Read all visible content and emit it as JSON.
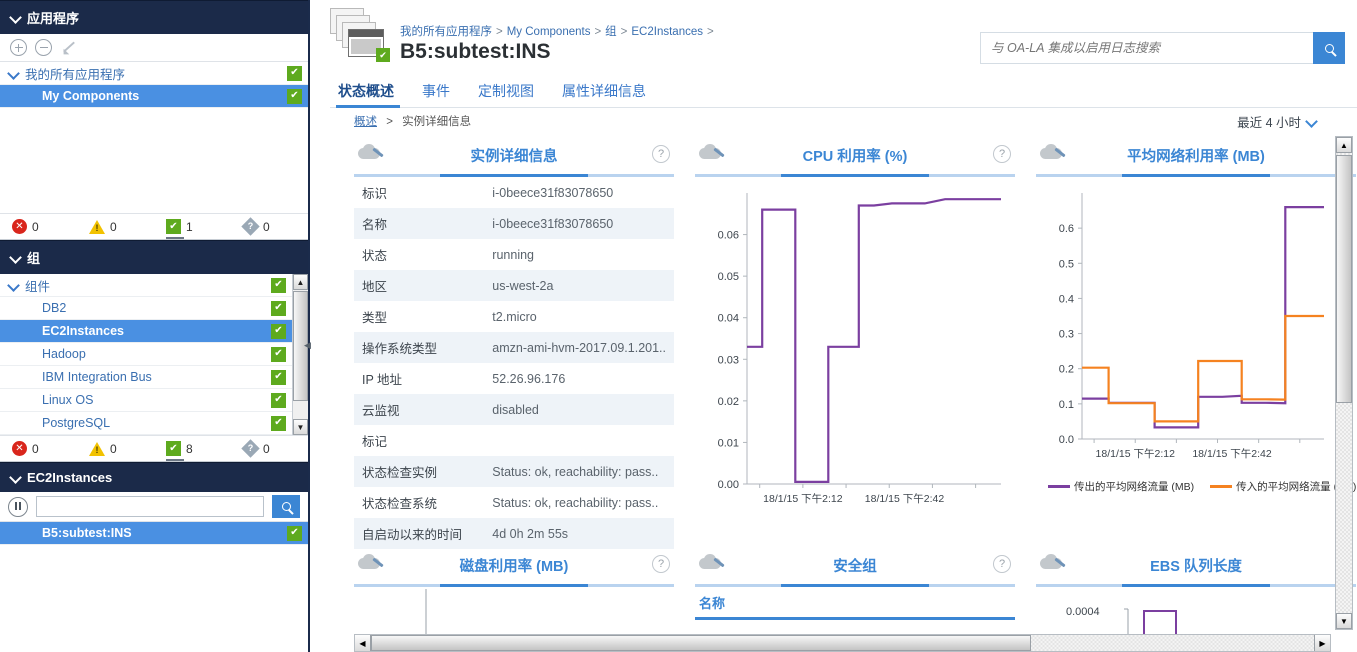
{
  "sidebar": {
    "applications": {
      "header": "应用程序",
      "toolbar": {
        "add": "add-icon",
        "remove": "remove-icon",
        "edit": "edit-icon"
      },
      "items": [
        {
          "label": "我的所有应用程序",
          "indent": 0,
          "selected": false,
          "expandable": true,
          "badge": "ok"
        },
        {
          "label": "My Components",
          "indent": 1,
          "selected": true,
          "expandable": false,
          "badge": "ok"
        }
      ],
      "status": [
        {
          "icon": "error-icon",
          "count": "0"
        },
        {
          "icon": "warning-icon",
          "count": "0"
        },
        {
          "icon": "ok-icon",
          "count": "1"
        },
        {
          "icon": "unknown-icon",
          "count": "0"
        }
      ]
    },
    "groups": {
      "header": "组",
      "items": [
        {
          "label": "组件",
          "indent": 0,
          "selected": false,
          "expandable": true,
          "badge": "ok"
        },
        {
          "label": "DB2",
          "indent": 1,
          "selected": false,
          "expandable": false,
          "badge": "ok"
        },
        {
          "label": "EC2Instances",
          "indent": 1,
          "selected": true,
          "expandable": false,
          "badge": "ok"
        },
        {
          "label": "Hadoop",
          "indent": 1,
          "selected": false,
          "expandable": false,
          "badge": "ok"
        },
        {
          "label": "IBM Integration Bus",
          "indent": 1,
          "selected": false,
          "expandable": false,
          "badge": "ok"
        },
        {
          "label": "Linux OS",
          "indent": 1,
          "selected": false,
          "expandable": false,
          "badge": "ok"
        },
        {
          "label": "PostgreSQL",
          "indent": 1,
          "selected": false,
          "expandable": false,
          "badge": "ok"
        }
      ],
      "status": [
        {
          "icon": "error-icon",
          "count": "0"
        },
        {
          "icon": "warning-icon",
          "count": "0"
        },
        {
          "icon": "ok-icon",
          "count": "8"
        },
        {
          "icon": "unknown-icon",
          "count": "0"
        }
      ]
    },
    "instances": {
      "header": "EC2Instances",
      "search_value": "",
      "search_placeholder": "",
      "items": [
        {
          "label": "B5:subtest:INS",
          "indent": 1,
          "selected": true,
          "expandable": false,
          "badge": "ok"
        }
      ]
    }
  },
  "header": {
    "breadcrumb": [
      "我的所有应用程序",
      "My Components",
      "组",
      "EC2Instances"
    ],
    "breadcrumb_separator": ">",
    "title": "B5:subtest:INS",
    "search_placeholder": "与 OA-LA 集成以启用日志搜索",
    "search_value": ""
  },
  "tabs": [
    {
      "label": "状态概述",
      "active": true
    },
    {
      "label": "事件",
      "active": false
    },
    {
      "label": "定制视图",
      "active": false
    },
    {
      "label": "属性详细信息",
      "active": false
    }
  ],
  "content": {
    "sub_breadcrumb": [
      "概述",
      "实例详细信息"
    ],
    "sub_breadcrumb_separator": ">",
    "time_range": "最近 4 小时"
  },
  "cards": {
    "instance_details": {
      "title": "实例详细信息",
      "help": "?",
      "rows": [
        {
          "key": "标识",
          "value": "i-0beece31f83078650"
        },
        {
          "key": "名称",
          "value": "i-0beece31f83078650"
        },
        {
          "key": "状态",
          "value": "running"
        },
        {
          "key": "地区",
          "value": "us-west-2a"
        },
        {
          "key": "类型",
          "value": "t2.micro"
        },
        {
          "key": "操作系统类型",
          "value": "amzn-ami-hvm-2017.09.1.201.."
        },
        {
          "key": "IP 地址",
          "value": "52.26.96.176"
        },
        {
          "key": "云监视",
          "value": "disabled"
        },
        {
          "key": "标记",
          "value": ""
        },
        {
          "key": "状态检查实例",
          "value": "Status: ok, reachability: pass.."
        },
        {
          "key": "状态检查系统",
          "value": "Status: ok, reachability: pass.."
        },
        {
          "key": "自启动以来的时间",
          "value": "4d 0h 2m 55s"
        }
      ]
    },
    "cpu": {
      "title": "CPU 利用率 (%)",
      "help": "?"
    },
    "network": {
      "title": "平均网络利用率 (MB)",
      "help": "?"
    },
    "disk": {
      "title": "磁盘利用率 (MB)",
      "help": "?"
    },
    "security_group": {
      "title": "安全组",
      "help": "?",
      "column": "名称"
    },
    "ebs": {
      "title": "EBS 队列长度",
      "help": "?",
      "first_tick": "0.0004"
    }
  },
  "chart_data": [
    {
      "id": "cpu",
      "type": "line",
      "title": "CPU 利用率 (%)",
      "xlabel": "",
      "ylabel": "",
      "ylim": [
        0.0,
        0.07
      ],
      "yticks": [
        "0.00",
        "0.01",
        "0.02",
        "0.03",
        "0.04",
        "0.05",
        "0.06"
      ],
      "xticks": [
        "18/1/15 下午2:12",
        "18/1/15 下午2:42"
      ],
      "grid": false,
      "legend": "none",
      "series": [
        {
          "name": "CPU 利用率 (%)",
          "color": "#7b3fa0",
          "x": [
            0,
            6,
            6,
            13,
            19,
            19,
            25,
            32,
            32,
            38,
            44,
            44,
            50,
            57,
            62,
            70,
            78,
            86,
            94,
            100
          ],
          "values": [
            0.033,
            0.033,
            0.066,
            0.066,
            0.066,
            0.0005,
            0.0005,
            0.0005,
            0.033,
            0.033,
            0.033,
            0.067,
            0.067,
            0.0675,
            0.0675,
            0.0675,
            0.0685,
            0.0685,
            0.0685,
            0.0685
          ]
        }
      ]
    },
    {
      "id": "network",
      "type": "line",
      "title": "平均网络利用率 (MB)",
      "xlabel": "",
      "ylabel": "",
      "ylim": [
        0.0,
        0.7
      ],
      "yticks": [
        "0.0",
        "0.1",
        "0.2",
        "0.3",
        "0.4",
        "0.5",
        "0.6"
      ],
      "xticks": [
        "18/1/15 下午2:12",
        "18/1/15 下午2:42"
      ],
      "grid": false,
      "legend": "bottom",
      "series": [
        {
          "name": "传出的平均网络流量 (MB)",
          "color": "#7b3fa0",
          "x": [
            0,
            11,
            11,
            22,
            30,
            30,
            40,
            48,
            48,
            58,
            66,
            66,
            76,
            84,
            84,
            92,
            100
          ],
          "values": [
            0.115,
            0.115,
            0.103,
            0.103,
            0.103,
            0.033,
            0.033,
            0.033,
            0.12,
            0.12,
            0.123,
            0.103,
            0.103,
            0.102,
            0.66,
            0.66,
            0.66
          ]
        },
        {
          "name": "传入的平均网络流量 (MB)",
          "color": "#f58220",
          "x": [
            0,
            11,
            11,
            22,
            30,
            30,
            40,
            48,
            48,
            58,
            66,
            66,
            76,
            84,
            84,
            92,
            100
          ],
          "values": [
            0.203,
            0.203,
            0.102,
            0.102,
            0.102,
            0.05,
            0.05,
            0.05,
            0.222,
            0.222,
            0.222,
            0.113,
            0.113,
            0.112,
            0.35,
            0.35,
            0.35
          ]
        }
      ]
    },
    {
      "id": "ebs",
      "type": "line",
      "title": "EBS 队列长度",
      "ylim": [
        0,
        0.0004
      ],
      "yticks": [
        "0.0004"
      ],
      "xticks": [],
      "grid": false,
      "legend": "none",
      "series": [
        {
          "name": "EBS 队列长度",
          "color": "#7b3fa0",
          "x": [
            0,
            20,
            20,
            55,
            55,
            100
          ],
          "values": [
            0,
            0,
            0.0004,
            0.0004,
            0,
            0
          ]
        }
      ]
    }
  ]
}
